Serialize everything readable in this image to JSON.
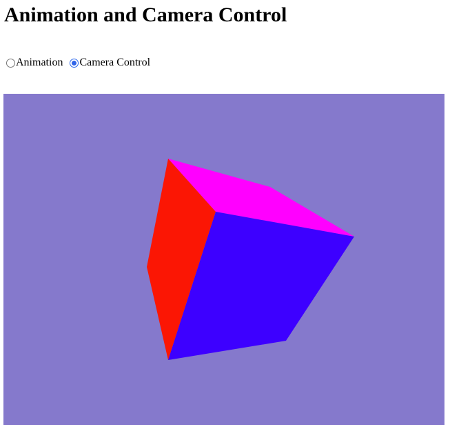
{
  "page": {
    "title": "Animation and Camera Control"
  },
  "mode": {
    "options": [
      {
        "label": "Animation",
        "checked": false
      },
      {
        "label": "Camera Control",
        "checked": true
      }
    ]
  },
  "scene": {
    "background_color": "#8579cc",
    "cube_faces": [
      {
        "name": "top",
        "color": "#ff00ff"
      },
      {
        "name": "left",
        "color": "#fb1604"
      },
      {
        "name": "front",
        "color": "#3d00ff"
      }
    ]
  }
}
